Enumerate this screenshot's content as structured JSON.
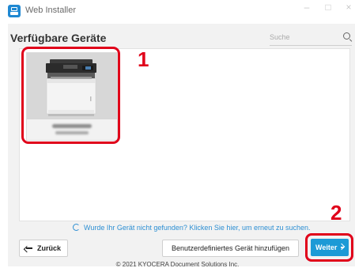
{
  "window": {
    "title": "Web Installer",
    "controls": {
      "minimize": "–",
      "maximize": "□",
      "close": "×"
    }
  },
  "header": {
    "title": "Verfügbare Geräte"
  },
  "search": {
    "placeholder": "Suche",
    "icon": "search-icon"
  },
  "device_list": {
    "devices": [
      {
        "icon": "printer-icon"
      }
    ]
  },
  "markers": {
    "first": "1",
    "second": "2"
  },
  "refresh": {
    "icon": "refresh-icon",
    "text": "Wurde Ihr Gerät nicht gefunden? Klicken Sie hier, um erneut zu suchen."
  },
  "buttons": {
    "back": "Zurück",
    "custom": "Benutzerdefiniertes Gerät hinzufügen",
    "next": "Weiter"
  },
  "footer": {
    "copyright": "© 2021 KYOCERA Document Solutions Inc."
  },
  "colors": {
    "accent": "#1c9ad6",
    "highlight": "#e0001a",
    "link": "#2d8fd3"
  }
}
